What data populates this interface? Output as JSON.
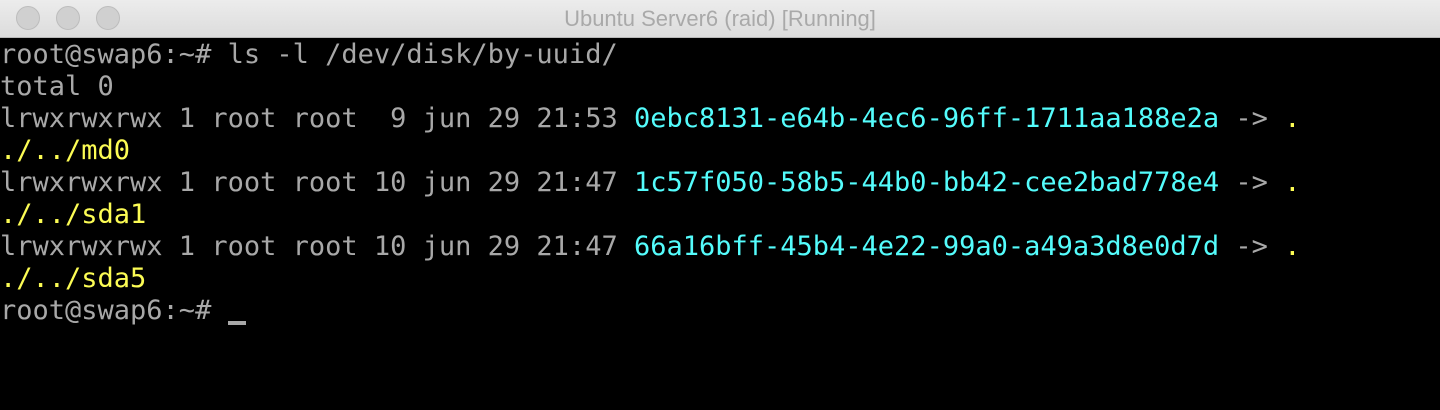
{
  "window": {
    "title": "Ubuntu Server6 (raid) [Running]",
    "buttons": [
      "close",
      "minimize",
      "zoom"
    ]
  },
  "terminal": {
    "prompt": "root@swap6:~# ",
    "command": "ls -l /dev/disk/by-uuid/",
    "total": "total 0",
    "entries": [
      {
        "meta": "lrwxrwxrwx 1 root root  9 jun 29 21:53 ",
        "uuid": "0ebc8131-e64b-4ec6-96ff-1711aa188e2a",
        "arrow": " -> ",
        "target_wrap1": ".",
        "target_wrap2": "./../md0"
      },
      {
        "meta": "lrwxrwxrwx 1 root root 10 jun 29 21:47 ",
        "uuid": "1c57f050-58b5-44b0-bb42-cee2bad778e4",
        "arrow": " -> ",
        "target_wrap1": ".",
        "target_wrap2": "./../sda1"
      },
      {
        "meta": "lrwxrwxrwx 1 root root 10 jun 29 21:47 ",
        "uuid": "66a16bff-45b4-4e22-99a0-a49a3d8e0d7d",
        "arrow": " -> ",
        "target_wrap1": ".",
        "target_wrap2": "./../sda5"
      }
    ],
    "final_prompt": "root@swap6:~# "
  },
  "colors": {
    "text": "#a8a8a8",
    "uuid": "#54fcfc",
    "link_target": "#fcfc54",
    "background": "#000000"
  }
}
